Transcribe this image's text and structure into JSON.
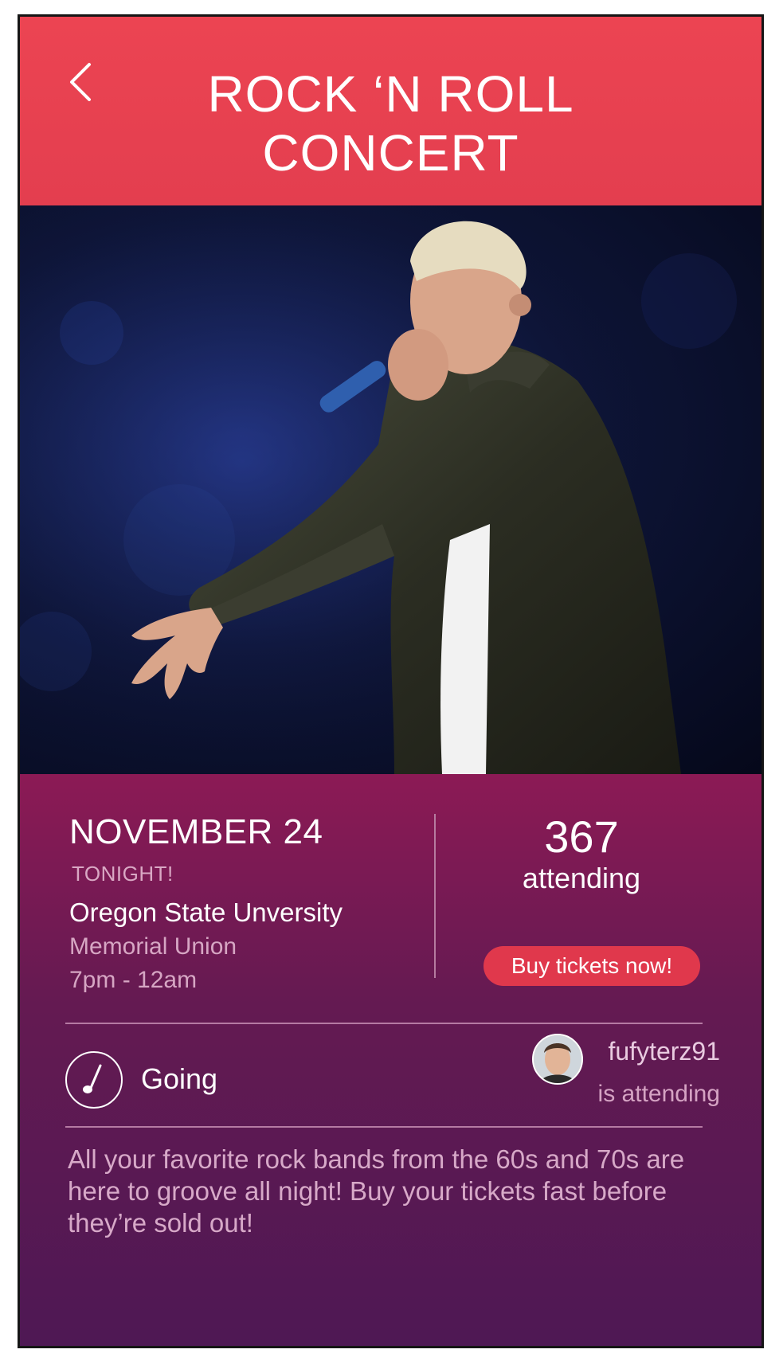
{
  "header": {
    "title_line1": "ROCK ‘N ROLL",
    "title_line2": "CONCERT"
  },
  "icons": {
    "back": "chevron-left-icon",
    "going": "music-note-icon"
  },
  "event": {
    "date": "NOVEMBER 24",
    "badge": "TONIGHT!",
    "venue": "Oregon State Unversity",
    "venue_sub": "Memorial Union",
    "time": "7pm - 12am",
    "attending_count": "367",
    "attending_label": "attending",
    "buy_button": "Buy tickets now!"
  },
  "rsvp": {
    "going_label": "Going"
  },
  "friend": {
    "username": "fufyterz91",
    "status": "is attending"
  },
  "description": "All your favorite rock bands from the 60s and 70s are here to groove all night! Buy your tickets fast before they’re sold out!",
  "colors": {
    "header": "#ec4452",
    "panel_top": "#8c1a55",
    "panel_bottom": "#4e1854",
    "button": "#e0384c"
  }
}
